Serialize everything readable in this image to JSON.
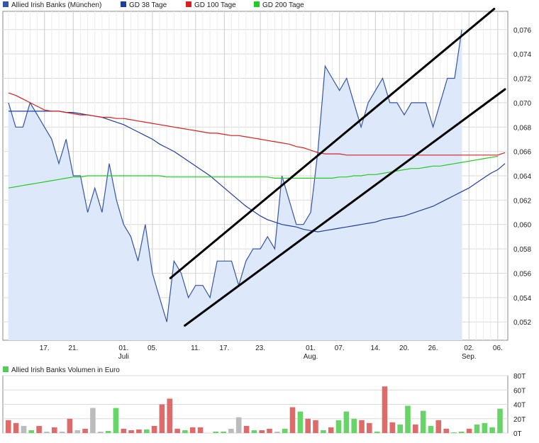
{
  "chart_data": [
    {
      "type": "line",
      "title": "",
      "legend_position": "top-left",
      "grid": true,
      "ylim": [
        0.0505,
        0.0775
      ],
      "y_ticks": [
        "0,052",
        "0,054",
        "0,056",
        "0,058",
        "0,060",
        "0,062",
        "0,064",
        "0,066",
        "0,068",
        "0,070",
        "0,072",
        "0,074",
        "0,076"
      ],
      "x_ticks": [
        {
          "day": 5,
          "label": "17."
        },
        {
          "day": 9,
          "label": "21."
        },
        {
          "day": 16,
          "label": "01.",
          "sub": "Juli"
        },
        {
          "day": 20,
          "label": "05."
        },
        {
          "day": 26,
          "label": "11."
        },
        {
          "day": 30,
          "label": "17."
        },
        {
          "day": 35,
          "label": "23."
        },
        {
          "day": 42,
          "label": "01.",
          "sub": "Aug."
        },
        {
          "day": 46,
          "label": "07."
        },
        {
          "day": 51,
          "label": "14."
        },
        {
          "day": 55,
          "label": "20."
        },
        {
          "day": 59,
          "label": "26."
        },
        {
          "day": 64,
          "label": "02.",
          "sub": "Sep."
        },
        {
          "day": 68,
          "label": "06."
        }
      ],
      "legend": [
        {
          "name": "Allied Irish Banks (München)",
          "color": "#3355aa"
        },
        {
          "name": "GD 38 Tage",
          "color": "#1f3fa0"
        },
        {
          "name": "GD 100 Tage",
          "color": "#d62020"
        },
        {
          "name": "GD 200 Tage",
          "color": "#22cc22"
        }
      ],
      "series": [
        {
          "name": "Allied Irish Banks (München)",
          "color": "#3355aa",
          "fill": "#dde8fa",
          "values": [
            0.07,
            0.068,
            0.068,
            0.07,
            0.069,
            0.068,
            0.067,
            0.065,
            0.067,
            0.064,
            0.064,
            0.061,
            0.063,
            0.061,
            0.065,
            0.062,
            0.06,
            0.059,
            0.057,
            0.06,
            0.056,
            0.054,
            0.052,
            0.057,
            0.056,
            0.054,
            0.055,
            0.055,
            0.054,
            0.057,
            0.057,
            0.057,
            0.055,
            0.057,
            0.058,
            0.058,
            0.059,
            0.058,
            0.064,
            0.062,
            0.06,
            0.06,
            0.061,
            0.066,
            0.073,
            0.072,
            0.071,
            0.072,
            0.07,
            0.068,
            0.07,
            0.071,
            0.072,
            0.07,
            0.07,
            0.069,
            0.07,
            0.07,
            0.07,
            0.068,
            0.07,
            0.072,
            0.072,
            0.076
          ]
        },
        {
          "name": "GD 38 Tage",
          "color": "#1f3fa0",
          "values": [
            0.0693,
            0.0693,
            0.0693,
            0.0693,
            0.0693,
            0.0693,
            0.0693,
            0.0693,
            0.0692,
            0.0692,
            0.0691,
            0.069,
            0.0689,
            0.0688,
            0.0686,
            0.0684,
            0.0682,
            0.0679,
            0.0676,
            0.0673,
            0.067,
            0.0666,
            0.0663,
            0.066,
            0.0656,
            0.0652,
            0.0648,
            0.0644,
            0.064,
            0.0635,
            0.063,
            0.0625,
            0.062,
            0.0615,
            0.0611,
            0.0607,
            0.0604,
            0.0602,
            0.06,
            0.0599,
            0.0598,
            0.0596,
            0.0595,
            0.0594,
            0.0595,
            0.0596,
            0.0597,
            0.0598,
            0.0599,
            0.06,
            0.0601,
            0.0602,
            0.0604,
            0.0605,
            0.0606,
            0.0607,
            0.0609,
            0.0611,
            0.0613,
            0.0615,
            0.0618,
            0.0621,
            0.0624,
            0.0627,
            0.063,
            0.0634,
            0.0638,
            0.0642,
            0.0645,
            0.065
          ]
        },
        {
          "name": "GD 100 Tage",
          "color": "#d62020",
          "values": [
            0.0708,
            0.0706,
            0.0703,
            0.07,
            0.0697,
            0.0694,
            0.0693,
            0.0693,
            0.0692,
            0.0691,
            0.069,
            0.069,
            0.0689,
            0.0688,
            0.0688,
            0.0687,
            0.0687,
            0.0686,
            0.0685,
            0.0684,
            0.0683,
            0.0682,
            0.0681,
            0.068,
            0.0679,
            0.0678,
            0.0677,
            0.0676,
            0.0675,
            0.0675,
            0.0674,
            0.0673,
            0.0673,
            0.0672,
            0.0671,
            0.067,
            0.0669,
            0.0668,
            0.0667,
            0.0666,
            0.0664,
            0.0663,
            0.0661,
            0.0659,
            0.0658,
            0.0658,
            0.0658,
            0.0657,
            0.0657,
            0.0657,
            0.0657,
            0.0657,
            0.0657,
            0.0657,
            0.0657,
            0.0657,
            0.0657,
            0.0657,
            0.0657,
            0.0657,
            0.0657,
            0.0657,
            0.0657,
            0.0657,
            0.0657,
            0.0657,
            0.0657,
            0.0657,
            0.0657,
            0.0659
          ]
        },
        {
          "name": "GD 200 Tage",
          "color": "#22cc22",
          "values": [
            0.063,
            0.0631,
            0.0632,
            0.0633,
            0.0634,
            0.0635,
            0.0636,
            0.0637,
            0.0638,
            0.0639,
            0.0639,
            0.064,
            0.064,
            0.064,
            0.064,
            0.064,
            0.064,
            0.064,
            0.064,
            0.064,
            0.064,
            0.064,
            0.0639,
            0.0639,
            0.0639,
            0.0639,
            0.0639,
            0.0639,
            0.0639,
            0.0639,
            0.0639,
            0.0639,
            0.0639,
            0.0639,
            0.0639,
            0.0639,
            0.0639,
            0.0638,
            0.0638,
            0.0638,
            0.0638,
            0.0638,
            0.0638,
            0.0638,
            0.0638,
            0.0638,
            0.0639,
            0.0639,
            0.064,
            0.064,
            0.0641,
            0.0641,
            0.0642,
            0.0643,
            0.0644,
            0.0645,
            0.0646,
            0.0646,
            0.0647,
            0.0648,
            0.0648,
            0.0649,
            0.065,
            0.0651,
            0.0652,
            0.0653,
            0.0654,
            0.0655,
            0.0656
          ]
        }
      ],
      "trendlines": [
        {
          "color": "#000000",
          "from": [
            22.5,
            0.0556
          ],
          "to": [
            67.5,
            0.0777
          ]
        },
        {
          "color": "#000000",
          "from": [
            24.5,
            0.0517
          ],
          "to": [
            69.0,
            0.0711
          ]
        }
      ]
    },
    {
      "type": "bar",
      "title": "",
      "legend": [
        {
          "name": "Allied Irish Banks Volumen in Euro",
          "color": "#55cc55"
        }
      ],
      "ylim": [
        0,
        80
      ],
      "y_ticks": [
        "0T",
        "20T",
        "40T",
        "60T",
        "80T"
      ],
      "colors": {
        "up": "#66d466",
        "down": "#de6a6a",
        "flat": "#bcbcbc"
      },
      "values": [
        18,
        14,
        10,
        4,
        10,
        2,
        8,
        2,
        20,
        4,
        6,
        35,
        2,
        3,
        35,
        6,
        4,
        5,
        5,
        10,
        40,
        48,
        6,
        4,
        8,
        8,
        0,
        2,
        2,
        6,
        22,
        10,
        4,
        4,
        6,
        2,
        6,
        36,
        30,
        20,
        18,
        4,
        8,
        18,
        30,
        20,
        18,
        14,
        2,
        65,
        15,
        12,
        38,
        12,
        31,
        10,
        18,
        6,
        1,
        2,
        6,
        12,
        14,
        8,
        34
      ],
      "dirs": [
        "d",
        "d",
        "f",
        "u",
        "d",
        "f",
        "d",
        "f",
        "d",
        "f",
        "d",
        "f",
        "f",
        "u",
        "u",
        "d",
        "d",
        "d",
        "u",
        "d",
        "d",
        "d",
        "d",
        "u",
        "d",
        "d",
        "f",
        "u",
        "u",
        "f",
        "f",
        "d",
        "u",
        "d",
        "d",
        "f",
        "u",
        "d",
        "u",
        "d",
        "d",
        "u",
        "d",
        "u",
        "u",
        "u",
        "d",
        "d",
        "u",
        "d",
        "d",
        "u",
        "u",
        "d",
        "u",
        "u",
        "d",
        "d",
        "u",
        "u",
        "d",
        "u",
        "u",
        "u",
        "u"
      ]
    }
  ]
}
